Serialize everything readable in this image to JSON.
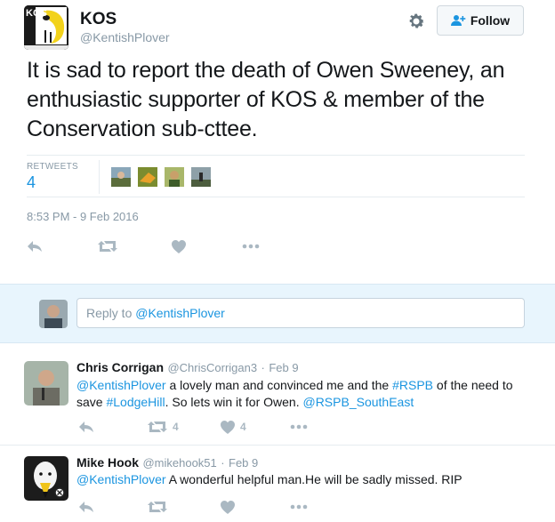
{
  "account": {
    "name": "KOS",
    "handle": "@KentishPlover",
    "avatar_letters": "KOS"
  },
  "follow_label": "Follow",
  "tweet": {
    "text": "It is sad to report the death of Owen Sweeney, an enthusiastic supporter of KOS & member of the Conservation sub-cttee.",
    "retweets_label": "RETWEETS",
    "retweets_count": "4",
    "timestamp": "8:53 PM - 9 Feb 2016"
  },
  "reply_box": {
    "prefix": "Reply to ",
    "mention": "@KentishPlover"
  },
  "replies": [
    {
      "name": "Chris Corrigan",
      "handle": "@ChrisCorrigan3",
      "dot": "·",
      "date": "Feb 9",
      "mention": "@KentishPlover",
      "text1": " a lovely man and  convinced me and the ",
      "tag1": "#RSPB",
      "text2": " of the need to save ",
      "tag2": "#LodgeHill",
      "text3": ". So lets win it for Owen. ",
      "mention2": "@RSPB_SouthEast",
      "retweets": "4",
      "likes": "4"
    },
    {
      "name": "Mike Hook",
      "handle": "@mikehook51",
      "dot": "·",
      "date": "Feb 9",
      "mention": "@KentishPlover",
      "text1": " A wonderful helpful man.He will be sadly missed.  RIP"
    }
  ],
  "icons": [
    "gear-icon",
    "follow-person-icon",
    "reply-icon",
    "retweet-icon",
    "like-icon",
    "more-icon"
  ]
}
